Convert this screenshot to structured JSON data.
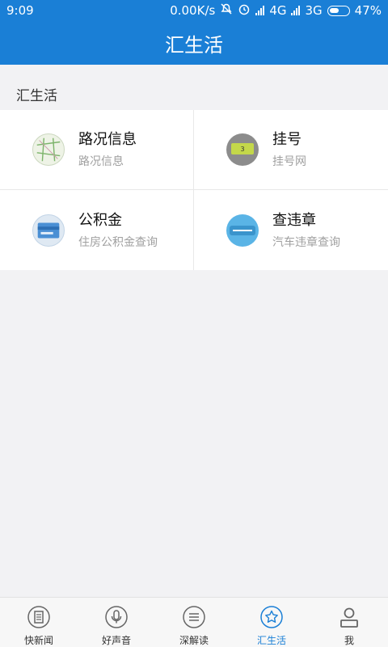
{
  "status_bar": {
    "time": "9:09",
    "network_speed": "0.00K/s",
    "network_1": "4G",
    "network_2": "3G",
    "battery": "47%"
  },
  "header": {
    "title": "汇生活"
  },
  "section": {
    "title": "汇生活"
  },
  "services": [
    {
      "title": "路况信息",
      "subtitle": "路况信息",
      "icon": "map-icon"
    },
    {
      "title": "挂号",
      "subtitle": "挂号网",
      "icon": "registration-icon"
    },
    {
      "title": "公积金",
      "subtitle": "住房公积金查询",
      "icon": "housing-fund-icon"
    },
    {
      "title": "查违章",
      "subtitle": "汽车违章查询",
      "icon": "traffic-violation-icon"
    }
  ],
  "tabs": [
    {
      "label": "快新闻",
      "icon": "news-icon"
    },
    {
      "label": "好声音",
      "icon": "microphone-icon"
    },
    {
      "label": "深解读",
      "icon": "list-icon"
    },
    {
      "label": "汇生活",
      "icon": "star-icon",
      "active": true
    },
    {
      "label": "我",
      "icon": "user-icon"
    }
  ],
  "colors": {
    "accent": "#1a7fd6",
    "background": "#f2f2f4"
  }
}
